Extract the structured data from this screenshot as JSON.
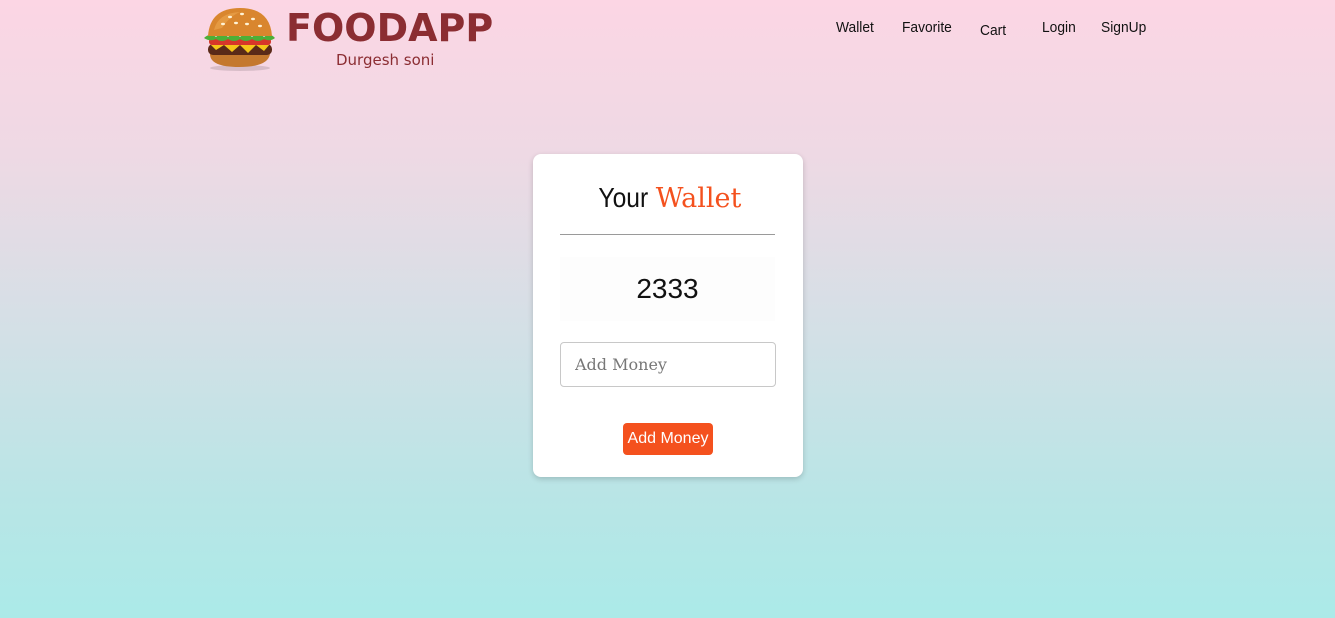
{
  "brand": {
    "name": "FOODAPP",
    "subtitle": "Durgesh soni",
    "logo_icon": "burger-icon",
    "color": "#8b2d32"
  },
  "nav": {
    "items": [
      {
        "label": "Wallet"
      },
      {
        "label": "Favorite"
      },
      {
        "label": "Cart"
      },
      {
        "label": "Login"
      },
      {
        "label": "SignUp"
      }
    ]
  },
  "wallet": {
    "title_prefix": "Your",
    "title_highlight": "Wallet",
    "balance": "2333",
    "input_placeholder": "Add Money",
    "input_value": "",
    "button_label": "Add Money"
  },
  "colors": {
    "accent": "#f4511e",
    "gradient_top": "#fcd6e4",
    "gradient_bottom": "#abeae8"
  }
}
